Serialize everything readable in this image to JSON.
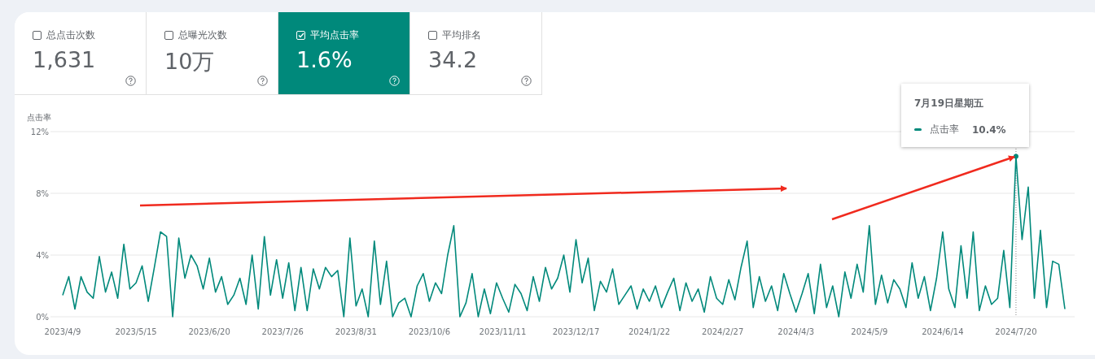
{
  "metrics": [
    {
      "label": "总点击次数",
      "value": "1,631",
      "selected": false
    },
    {
      "label": "总曝光次数",
      "value": "10万",
      "selected": false
    },
    {
      "label": "平均点击率",
      "value": "1.6%",
      "selected": true
    },
    {
      "label": "平均排名",
      "value": "34.2",
      "selected": false
    }
  ],
  "chart": {
    "chart_data": {
      "type": "line",
      "ylabel": "点击率",
      "ylim": [
        0,
        12
      ],
      "yticks": [
        {
          "value": 0,
          "label": "0%"
        },
        {
          "value": 4,
          "label": "4%"
        },
        {
          "value": 8,
          "label": "8%"
        },
        {
          "value": 12,
          "label": "12%"
        }
      ],
      "categories": [
        "2023/4/9",
        null,
        null,
        null,
        null,
        null,
        null,
        null,
        null,
        null,
        null,
        null,
        "2023/5/15",
        null,
        null,
        null,
        null,
        null,
        null,
        null,
        null,
        null,
        null,
        null,
        "2023/6/20",
        null,
        null,
        null,
        null,
        null,
        null,
        null,
        null,
        null,
        null,
        null,
        "2023/7/26",
        null,
        null,
        null,
        null,
        null,
        null,
        null,
        null,
        null,
        null,
        null,
        "2023/8/31",
        null,
        null,
        null,
        null,
        null,
        null,
        null,
        null,
        null,
        null,
        null,
        "2023/10/6",
        null,
        null,
        null,
        null,
        null,
        null,
        null,
        null,
        null,
        null,
        null,
        "2023/11/11",
        null,
        null,
        null,
        null,
        null,
        null,
        null,
        null,
        null,
        null,
        null,
        "2023/12/17",
        null,
        null,
        null,
        null,
        null,
        null,
        null,
        null,
        null,
        null,
        null,
        "2024/1/22",
        null,
        null,
        null,
        null,
        null,
        null,
        null,
        null,
        null,
        null,
        null,
        "2024/2/27",
        null,
        null,
        null,
        null,
        null,
        null,
        null,
        null,
        null,
        null,
        null,
        "2024/4/3",
        null,
        null,
        null,
        null,
        null,
        null,
        null,
        null,
        null,
        null,
        null,
        "2024/5/9",
        null,
        null,
        null,
        null,
        null,
        null,
        null,
        null,
        null,
        null,
        null,
        "2024/6/14",
        null,
        null,
        null,
        null,
        null,
        null,
        null,
        null,
        null,
        null,
        null,
        "2024/7/20",
        null,
        null,
        null,
        null,
        null,
        null,
        null,
        null
      ],
      "series": [
        {
          "name": "点击率",
          "color": "#00897b",
          "values": [
            1.4,
            2.6,
            0.5,
            2.6,
            1.6,
            1.2,
            3.9,
            1.6,
            2.9,
            1.2,
            4.7,
            1.8,
            2.2,
            3.3,
            1.0,
            3.2,
            5.5,
            5.2,
            0.0,
            5.1,
            2.5,
            4.0,
            3.3,
            1.8,
            3.8,
            1.6,
            2.6,
            0.8,
            1.4,
            2.5,
            0.8,
            4.0,
            0.5,
            5.2,
            1.4,
            3.7,
            1.2,
            3.5,
            0.4,
            3.2,
            0.4,
            3.1,
            1.8,
            3.2,
            2.6,
            3.0,
            0.0,
            5.1,
            0.7,
            1.8,
            0.0,
            4.9,
            0.8,
            3.6,
            0.0,
            0.9,
            1.2,
            0.0,
            2.0,
            2.8,
            1.0,
            2.2,
            1.5,
            4.0,
            5.9,
            0.0,
            0.9,
            2.8,
            0.0,
            1.8,
            0.2,
            2.2,
            1.2,
            0.3,
            2.1,
            1.5,
            0.4,
            2.6,
            1.0,
            3.2,
            1.8,
            2.5,
            4.0,
            1.6,
            5.0,
            2.2,
            3.8,
            0.4,
            2.3,
            1.6,
            3.1,
            0.8,
            1.4,
            2.0,
            0.5,
            1.8,
            1.0,
            2.0,
            0.6,
            1.6,
            2.5,
            0.4,
            2.2,
            1.0,
            1.8,
            0.3,
            2.6,
            1.2,
            0.8,
            2.4,
            1.1,
            3.2,
            4.9,
            0.6,
            2.6,
            1.0,
            2.0,
            0.4,
            2.8,
            1.5,
            0.3,
            1.5,
            2.8,
            0.2,
            3.4,
            0.6,
            2.0,
            0.0,
            2.9,
            1.2,
            3.4,
            1.6,
            5.9,
            0.8,
            2.7,
            0.9,
            2.4,
            1.8,
            0.6,
            3.5,
            1.2,
            2.6,
            0.4,
            2.5,
            5.5,
            1.8,
            0.6,
            4.6,
            1.2,
            5.5,
            0.4,
            2.0,
            0.8,
            1.2,
            4.3,
            0.6,
            10.4,
            5.0,
            8.4,
            1.2,
            5.6,
            0.6,
            3.6,
            3.4,
            0.5
          ]
        }
      ]
    },
    "tooltip": {
      "date": "7月19日星期五",
      "value": "10.4%"
    }
  }
}
